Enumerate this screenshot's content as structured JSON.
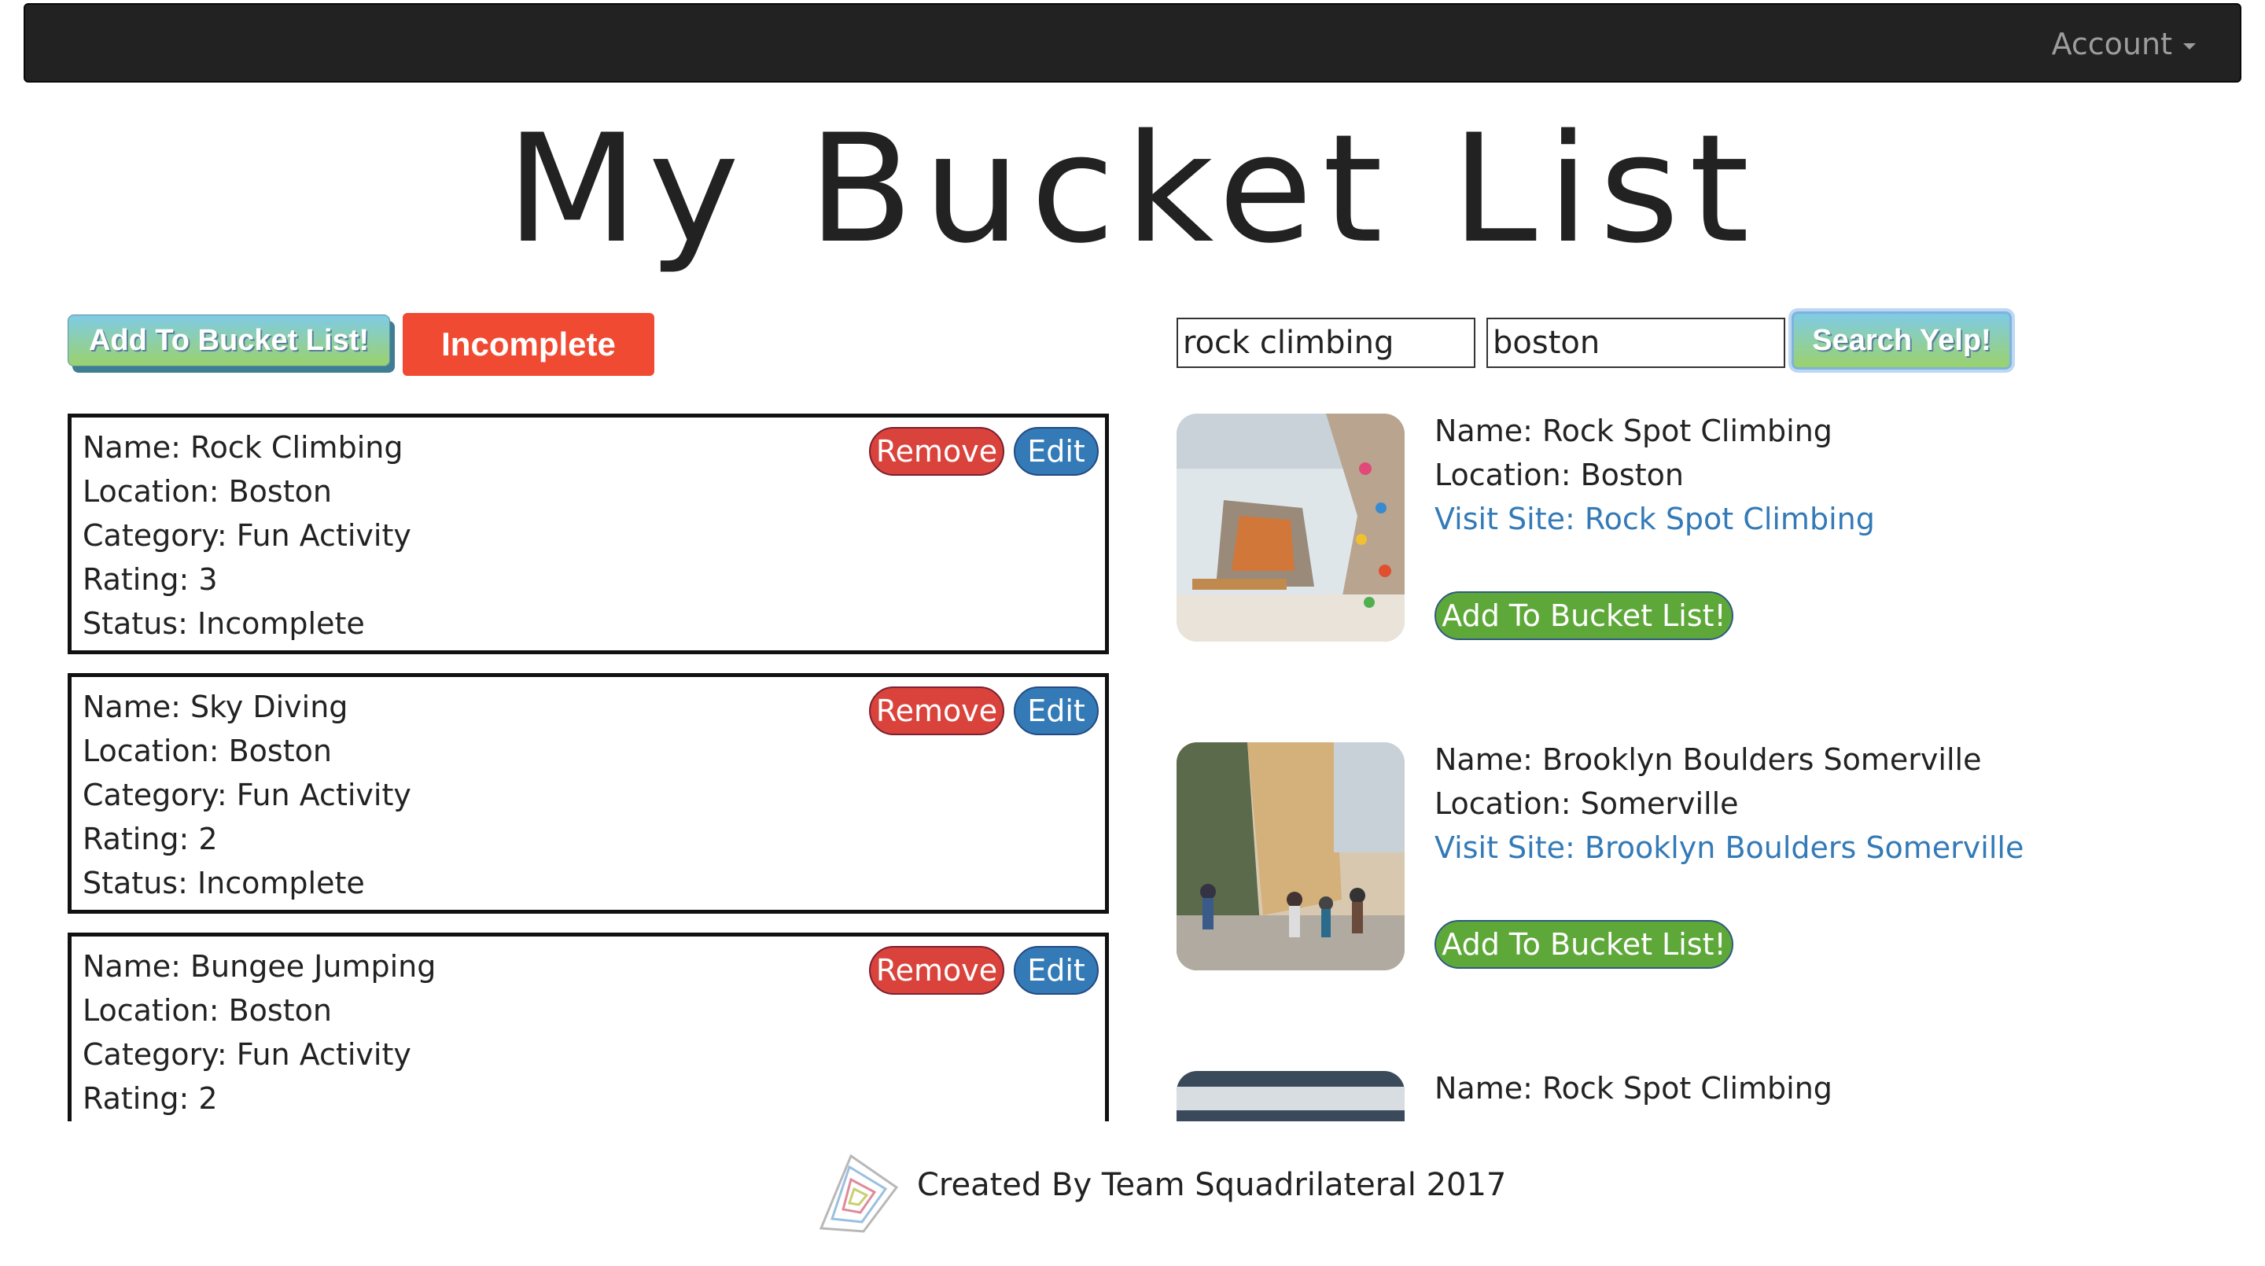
{
  "navbar": {
    "account_label": "Account"
  },
  "page_title": "My Bucket List",
  "left_controls": {
    "add_button": "Add To Bucket List!",
    "filter_button": "Incomplete"
  },
  "search": {
    "term_value": "rock climbing",
    "location_value": "boston",
    "button": "Search Yelp!"
  },
  "items": [
    {
      "name": "Name: Rock Climbing",
      "location": "Location: Boston",
      "category": "Category: Fun Activity",
      "rating": "Rating: 3",
      "status": "Status: Incomplete"
    },
    {
      "name": "Name: Sky Diving",
      "location": "Location: Boston",
      "category": "Category: Fun Activity",
      "rating": "Rating: 2",
      "status": "Status: Incomplete"
    },
    {
      "name": "Name: Bungee Jumping",
      "location": "Location: Boston",
      "category": "Category: Fun Activity",
      "rating": "Rating: 2",
      "status": ""
    }
  ],
  "item_actions": {
    "remove": "Remove",
    "edit": "Edit"
  },
  "results": [
    {
      "name": "Name: Rock Spot Climbing",
      "location": "Location: Boston",
      "link": "Visit Site: Rock Spot Climbing",
      "add": "Add To Bucket List!"
    },
    {
      "name": "Name: Brooklyn Boulders Somerville",
      "location": "Location: Somerville",
      "link": "Visit Site: Brooklyn Boulders Somerville",
      "add": "Add To Bucket List!"
    },
    {
      "name": "Name: Rock Spot Climbing",
      "location": "",
      "link": "",
      "add": ""
    }
  ],
  "footer": {
    "text": "Created By Team Squadrilateral 2017"
  },
  "colors": {
    "navbar": "#222222",
    "remove": "#d9433c",
    "edit": "#337ab7",
    "incomplete": "#f04b32",
    "link": "#337ab7",
    "result_add": "#5ea83a"
  }
}
